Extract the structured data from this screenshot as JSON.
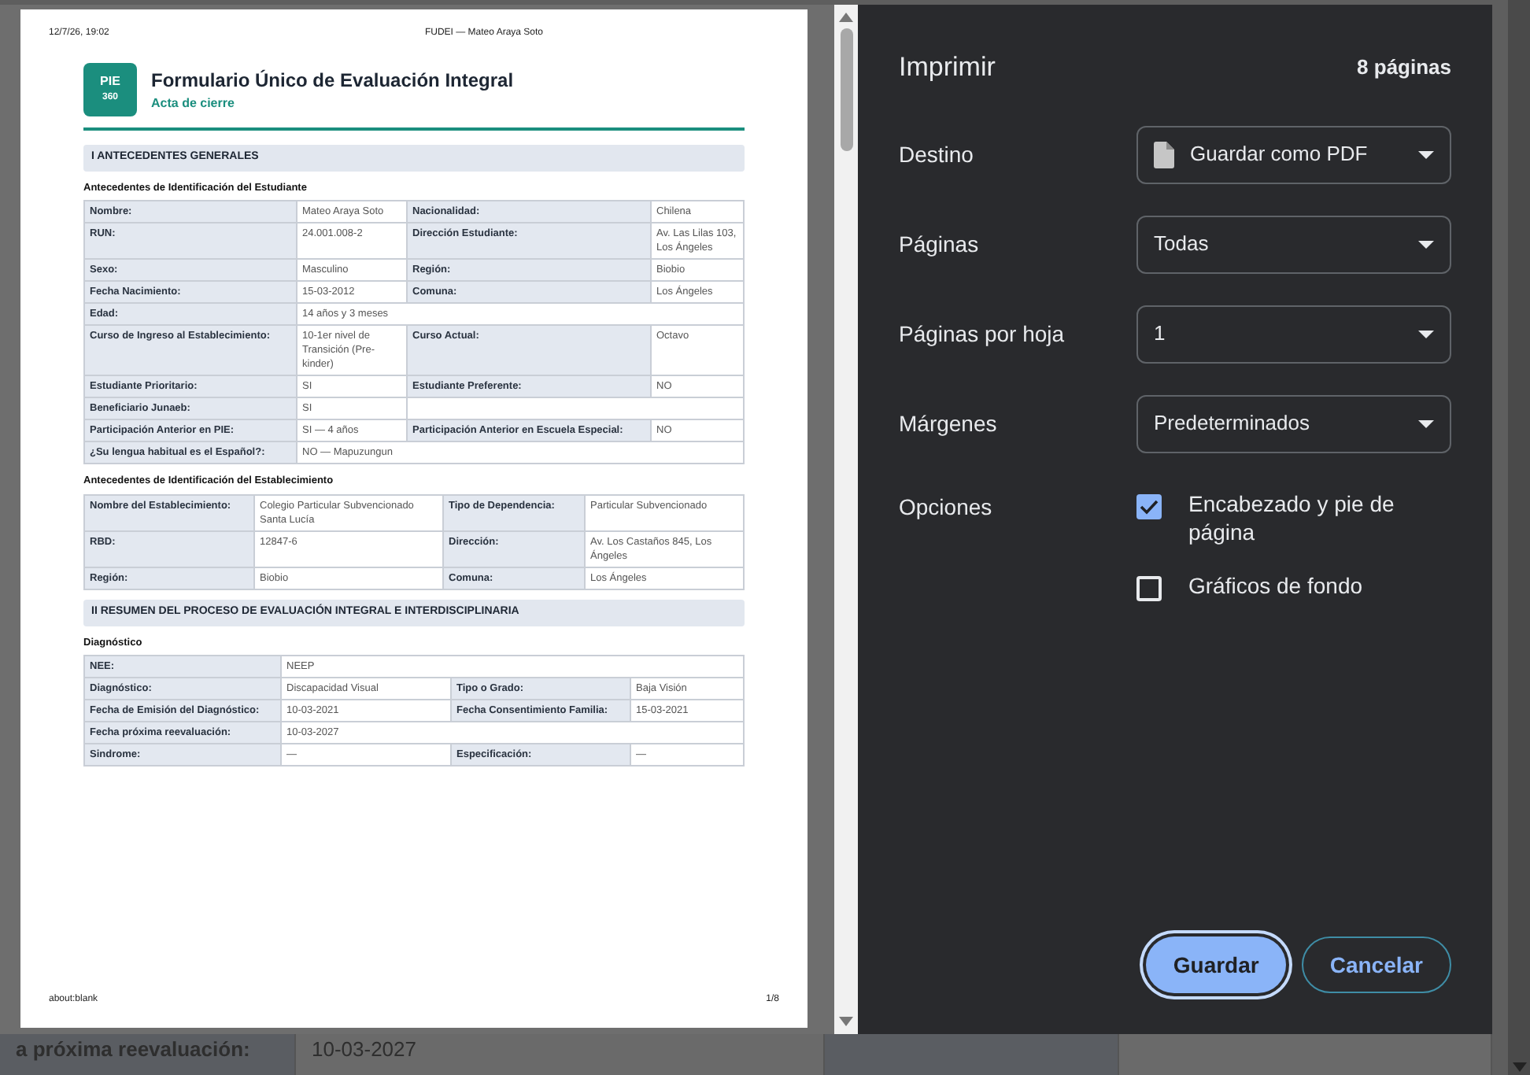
{
  "background_row": [
    {
      "kind": "label",
      "text": "a próxima reevaluación:"
    },
    {
      "kind": "value",
      "text": "10-03-2027"
    },
    {
      "kind": "label"
    },
    {
      "kind": "value"
    }
  ],
  "preview": {
    "header_left": "12/7/26, 19:02",
    "header_center": "FUDEI — Mateo Araya Soto",
    "logo": [
      "PIE",
      "360"
    ],
    "title": "Formulario Único de Evaluación Integral",
    "subtitle": "Acta de cierre",
    "sections": [
      {
        "heading": "I ANTECEDENTES GENERALES",
        "blocks": [
          {
            "title": "Antecedentes de Identificación del Estudiante",
            "rows": [
              {
                "kind": "split",
                "cells": [
                  "Nombre:",
                  "Mateo Araya Soto",
                  "Nacionalidad:",
                  "Chilena"
                ]
              },
              {
                "kind": "split",
                "cells": [
                  "RUN:",
                  "24.001.008-2",
                  "Dirección Estudiante:",
                  "Av. Las Lilas 103, Los Ángeles"
                ]
              },
              {
                "kind": "split",
                "cells": [
                  "Sexo:",
                  "Masculino",
                  "Región:",
                  "Biobio"
                ]
              },
              {
                "kind": "split",
                "cells": [
                  "Fecha Nacimiento:",
                  "15-03-2012",
                  "Comuna:",
                  "Los Ángeles"
                ]
              },
              {
                "kind": "full",
                "cells": [
                  "Edad:",
                  "14 años y 3 meses"
                ]
              },
              {
                "kind": "split",
                "cells": [
                  "Curso de Ingreso al Establecimiento:",
                  "10-1er nivel de Transición (Pre-kinder)",
                  "Curso Actual:",
                  "Octavo"
                ]
              },
              {
                "kind": "split",
                "cells": [
                  "Estudiante Prioritario:",
                  "SI",
                  "Estudiante Preferente:",
                  "NO"
                ]
              },
              {
                "kind": "half",
                "cells": [
                  "Beneficiario Junaeb:",
                  "SI"
                ]
              },
              {
                "kind": "split",
                "cells": [
                  "Participación Anterior en PIE:",
                  "SI — 4 años",
                  "Participación Anterior en Escuela Especial:",
                  "NO"
                ]
              },
              {
                "kind": "full",
                "cells": [
                  "¿Su lengua habitual es el Español?:",
                  "NO — Mapuzungun"
                ]
              }
            ]
          },
          {
            "title": "Antecedentes de Identificación del Establecimiento",
            "rows": [
              {
                "kind": "split",
                "cells": [
                  "Nombre del Establecimiento:",
                  "Colegio Particular Subvencionado Santa Lucía",
                  "Tipo de Dependencia:",
                  "Particular Subvencionado"
                ]
              },
              {
                "kind": "split",
                "cells": [
                  "RBD:",
                  "12847-6",
                  "Dirección:",
                  "Av. Los Castaños 845, Los Ángeles"
                ]
              },
              {
                "kind": "split",
                "cells": [
                  "Región:",
                  "Biobio",
                  "Comuna:",
                  "Los Ángeles"
                ]
              }
            ]
          }
        ]
      },
      {
        "heading": "II RESUMEN DEL PROCESO DE EVALUACIÓN INTEGRAL E INTERDISCIPLINARIA",
        "blocks": [
          {
            "title": "Diagnóstico",
            "rows": [
              {
                "kind": "full",
                "cells": [
                  "NEE:",
                  "NEEP"
                ]
              },
              {
                "kind": "split",
                "cells": [
                  "Diagnóstico:",
                  "Discapacidad Visual",
                  "Tipo o Grado:",
                  "Baja Visión"
                ]
              },
              {
                "kind": "split",
                "cells": [
                  "Fecha de Emisión del Diagnóstico:",
                  "10-03-2021",
                  "Fecha Consentimiento Familia:",
                  "15-03-2021"
                ]
              },
              {
                "kind": "full",
                "cells": [
                  "Fecha próxima reevaluación:",
                  "10-03-2027"
                ]
              },
              {
                "kind": "split",
                "cells": [
                  "Sindrome:",
                  "—",
                  "Especificación:",
                  "—"
                ]
              }
            ]
          }
        ]
      }
    ],
    "footer_left": "about:blank",
    "footer_right": "1/8"
  },
  "print_panel": {
    "title": "Imprimir",
    "page_count": "8 páginas",
    "settings": [
      {
        "label": "Destino",
        "value": "Guardar como PDF",
        "kind": "pdf"
      },
      {
        "label": "Páginas",
        "value": "Todas",
        "kind": "plain"
      },
      {
        "label": "Páginas por hoja",
        "value": "1",
        "kind": "plain"
      },
      {
        "label": "Márgenes",
        "value": "Predeterminados",
        "kind": "plain"
      }
    ],
    "options_label": "Opciones",
    "options": [
      {
        "label": "Encabezado y pie de página",
        "checked": true
      },
      {
        "label": "Gráficos de fondo",
        "checked": false
      }
    ],
    "buttons": [
      {
        "label": "Guardar",
        "kind": "primary"
      },
      {
        "label": "Cancelar",
        "kind": "secondary"
      }
    ]
  }
}
